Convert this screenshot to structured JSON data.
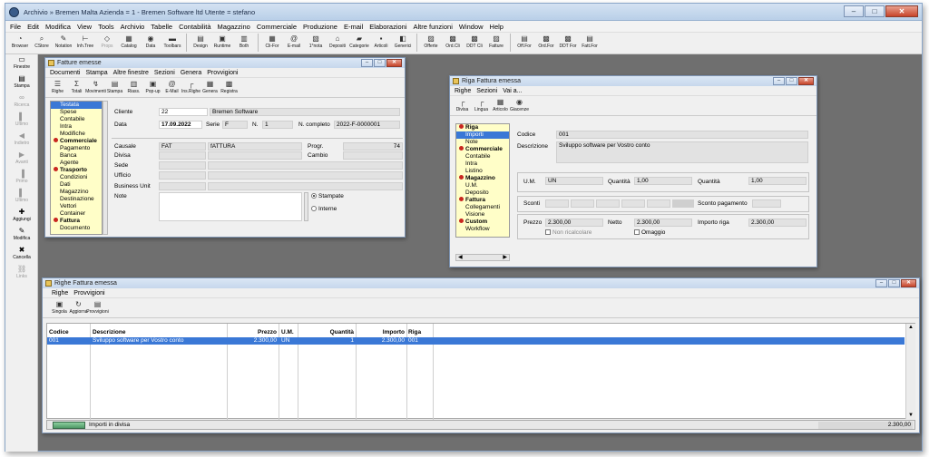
{
  "app": {
    "title": "Archivio » Bremen Malta  Azienda = 1 - Bremen Software ltd   Utente = stefano"
  },
  "menu": [
    "File",
    "Edit",
    "Modifica",
    "View",
    "Tools",
    "Archivio",
    "Tabelle",
    "Contabilità",
    "Magazzino",
    "Commerciale",
    "Produzione",
    "E-mail",
    "Elaborazioni",
    "Altre funzioni",
    "Window",
    "Help"
  ],
  "toolbar": [
    {
      "label": "Browser",
      "icon": "browser-icon",
      "enabled": true
    },
    {
      "label": "CStore",
      "icon": "store-icon",
      "enabled": true
    },
    {
      "label": "Notation",
      "icon": "notation-icon",
      "enabled": true
    },
    {
      "label": "Inh.Tree",
      "icon": "tree-icon",
      "enabled": true
    },
    {
      "label": "Props",
      "icon": "props-icon",
      "enabled": false
    },
    {
      "label": "Catalog",
      "icon": "catalog-icon",
      "enabled": true
    },
    {
      "label": "Data",
      "icon": "data-icon",
      "enabled": true
    },
    {
      "label": "Toolbars",
      "icon": "toolbars-icon",
      "enabled": true
    },
    {
      "sep": true
    },
    {
      "label": "Design",
      "icon": "design-icon",
      "enabled": true
    },
    {
      "label": "Runtime",
      "icon": "runtime-icon",
      "enabled": true
    },
    {
      "label": "Both",
      "icon": "both-icon",
      "enabled": true
    },
    {
      "sep": true
    },
    {
      "label": "Cli-For",
      "icon": "clifor-icon",
      "enabled": true
    },
    {
      "label": "E-mail",
      "icon": "email-icon",
      "enabled": true
    },
    {
      "label": "1°nota",
      "icon": "nota-icon",
      "enabled": true
    },
    {
      "label": "Depositi",
      "icon": "depositi-icon",
      "enabled": true
    },
    {
      "label": "Categorie",
      "icon": "categorie-icon",
      "enabled": true
    },
    {
      "label": "Articoli",
      "icon": "articoli-icon",
      "enabled": true
    },
    {
      "label": "Generici",
      "icon": "generici-icon",
      "enabled": true
    },
    {
      "sep": true
    },
    {
      "label": "Offerte",
      "icon": "offerte-icon",
      "enabled": true
    },
    {
      "label": "Ord.Cli",
      "icon": "ordcli-icon",
      "enabled": true
    },
    {
      "label": "DDT Cli",
      "icon": "ddtcli-icon",
      "enabled": true
    },
    {
      "label": "Fatture",
      "icon": "fatture-icon",
      "enabled": true
    },
    {
      "sep": true
    },
    {
      "label": "Off.For",
      "icon": "offfor-icon",
      "enabled": true
    },
    {
      "label": "Ord.For",
      "icon": "ordfor-icon",
      "enabled": true
    },
    {
      "label": "DDT For",
      "icon": "ddtfor-icon",
      "enabled": true
    },
    {
      "label": "Fatt.For",
      "icon": "fattfor-icon",
      "enabled": true
    }
  ],
  "lefttools": [
    {
      "label": "Finestre",
      "icon": "window-icon",
      "enabled": true
    },
    {
      "label": "Stampa",
      "icon": "print-icon",
      "enabled": true
    },
    {
      "label": "Ricerca",
      "icon": "binoculars-icon",
      "enabled": false
    },
    {
      "label": "Ultimo",
      "icon": "last-icon",
      "enabled": false
    },
    {
      "label": "Indietro",
      "icon": "back-icon",
      "enabled": false
    },
    {
      "label": "Avanti",
      "icon": "forward-icon",
      "enabled": false
    },
    {
      "label": "Primo",
      "icon": "first-icon",
      "enabled": false
    },
    {
      "label": "Ultimo",
      "icon": "last-icon",
      "enabled": false
    },
    {
      "label": "Aggiungi",
      "icon": "add-icon",
      "enabled": true
    },
    {
      "label": "Modifica",
      "icon": "edit-icon",
      "enabled": true
    },
    {
      "label": "Cancella",
      "icon": "delete-icon",
      "enabled": true
    },
    {
      "label": "Links",
      "icon": "link-icon",
      "enabled": false
    }
  ],
  "fattura": {
    "title": "Fatture emesse",
    "menu": [
      "Documenti",
      "Stampa",
      "Altre finestre",
      "Sezioni",
      "Genera",
      "Provvigioni"
    ],
    "tools": [
      "Righe",
      "Totali",
      "Movimenti",
      "Stampa",
      "Riass.",
      "Pop-up",
      "E-Mail",
      "Ins.Righe",
      "Genera",
      "Registra"
    ],
    "tool_icons": [
      "rows-icon",
      "sigma-icon",
      "movements-icon",
      "print-icon",
      "summary-icon",
      "popup-icon",
      "at-icon",
      "insert-rows-icon",
      "generate-icon",
      "register-icon"
    ],
    "sections": [
      {
        "label": "Testata",
        "head": false,
        "selected": true
      },
      {
        "label": "Spese",
        "head": false
      },
      {
        "label": "Contabile",
        "head": false
      },
      {
        "label": "Intra",
        "head": false
      },
      {
        "label": "Modifiche",
        "head": false
      },
      {
        "label": "Commerciale",
        "head": true
      },
      {
        "label": "Pagamento",
        "head": false
      },
      {
        "label": "Banca",
        "head": false
      },
      {
        "label": "Agente",
        "head": false
      },
      {
        "label": "Trasporto",
        "head": true
      },
      {
        "label": "Condizioni",
        "head": false
      },
      {
        "label": "Dati",
        "head": false
      },
      {
        "label": "Magazzino",
        "head": false
      },
      {
        "label": "Destinazione",
        "head": false
      },
      {
        "label": "Vettori",
        "head": false
      },
      {
        "label": "Container",
        "head": false
      },
      {
        "label": "Fattura",
        "head": true
      },
      {
        "label": "Documento",
        "head": false
      }
    ],
    "labels": {
      "cliente": "Cliente",
      "data": "Data",
      "serie": "Serie",
      "n": "N.",
      "ncompleto": "N. completo",
      "causale": "Causale",
      "divisa": "Divisa",
      "sede": "Sede",
      "ufficio": "Ufficio",
      "bu": "Business Unit",
      "note": "Note",
      "progr": "Progr.",
      "cambio": "Cambio"
    },
    "values": {
      "cliente_code": "22",
      "cliente_name": "Bremen Software",
      "data": "17.09.2022",
      "serie": "F",
      "n": "1",
      "ncompleto": "2022-F-0000001",
      "causale_code": "FAT",
      "causale_desc": "fATTURA",
      "progr": "74"
    },
    "radios": {
      "stampate": "Stampate",
      "interne": "Interne"
    }
  },
  "riga": {
    "title": "Riga Fattura emessa",
    "menu": [
      "Righe",
      "Sezioni",
      "Vai a..."
    ],
    "tools": [
      "Divisa",
      "Lingua",
      "Articolo",
      "Giacenze"
    ],
    "tool_icons": [
      "currency-icon",
      "language-icon",
      "article-icon",
      "stock-icon"
    ],
    "sections": [
      {
        "label": "Riga",
        "head": true
      },
      {
        "label": "Importi",
        "head": false,
        "selected": true
      },
      {
        "label": "Note",
        "head": false
      },
      {
        "label": "Commerciale",
        "head": true
      },
      {
        "label": "Contabile",
        "head": false
      },
      {
        "label": "Intra",
        "head": false
      },
      {
        "label": "Listino",
        "head": false
      },
      {
        "label": "Magazzino",
        "head": true
      },
      {
        "label": "U.M.",
        "head": false
      },
      {
        "label": "Deposito",
        "head": false
      },
      {
        "label": "Fattura",
        "head": true
      },
      {
        "label": "Collegamenti",
        "head": false
      },
      {
        "label": "Visione",
        "head": false
      },
      {
        "label": "Custom",
        "head": true
      },
      {
        "label": "Workflow",
        "head": false
      }
    ],
    "labels": {
      "codice": "Codice",
      "descrizione": "Descrizione",
      "um": "U.M.",
      "quantita1": "Quantità",
      "quantita2": "Quantità",
      "sconti": "Sconti",
      "sconto_pag": "Sconto pagamento",
      "prezzo": "Prezzo",
      "netto": "Netto",
      "importo": "Importo riga",
      "non_ricalc": "Non ricalcolare",
      "omaggio": "Omaggio"
    },
    "values": {
      "codice": "001",
      "descrizione": "Sviluppo software per Vostro conto",
      "um": "UN",
      "quantita1": "1,00",
      "quantita2": "1,00",
      "prezzo": "2.300,00",
      "netto": "2.300,00",
      "importo": "2.300,00"
    }
  },
  "righe": {
    "title": "Righe Fattura emessa",
    "menu": [
      "Righe",
      "Provvigioni"
    ],
    "tools": [
      "Singola",
      "Aggiorna",
      "Provvigioni"
    ],
    "tool_icons": [
      "single-row-icon",
      "refresh-icon",
      "commission-icon"
    ],
    "columns": [
      "Codice",
      "Descrizione",
      "Prezzo",
      "U.M.",
      "Quantità",
      "Importo",
      "Riga"
    ],
    "rows": [
      {
        "codice": "001",
        "descrizione": "Sviluppo software per Vostro conto",
        "prezzo": "2.300,00",
        "um": "UN",
        "quantita": "1",
        "importo": "2.300,00",
        "riga": "001"
      }
    ],
    "footer": {
      "tab": "Importi in divisa",
      "total": "2.300,00"
    }
  },
  "colors": {
    "selection": "#3a78d6",
    "side_bg": "#fffec8",
    "side_head_dot": "#c9261f",
    "desktop": "#6f6f6f"
  }
}
